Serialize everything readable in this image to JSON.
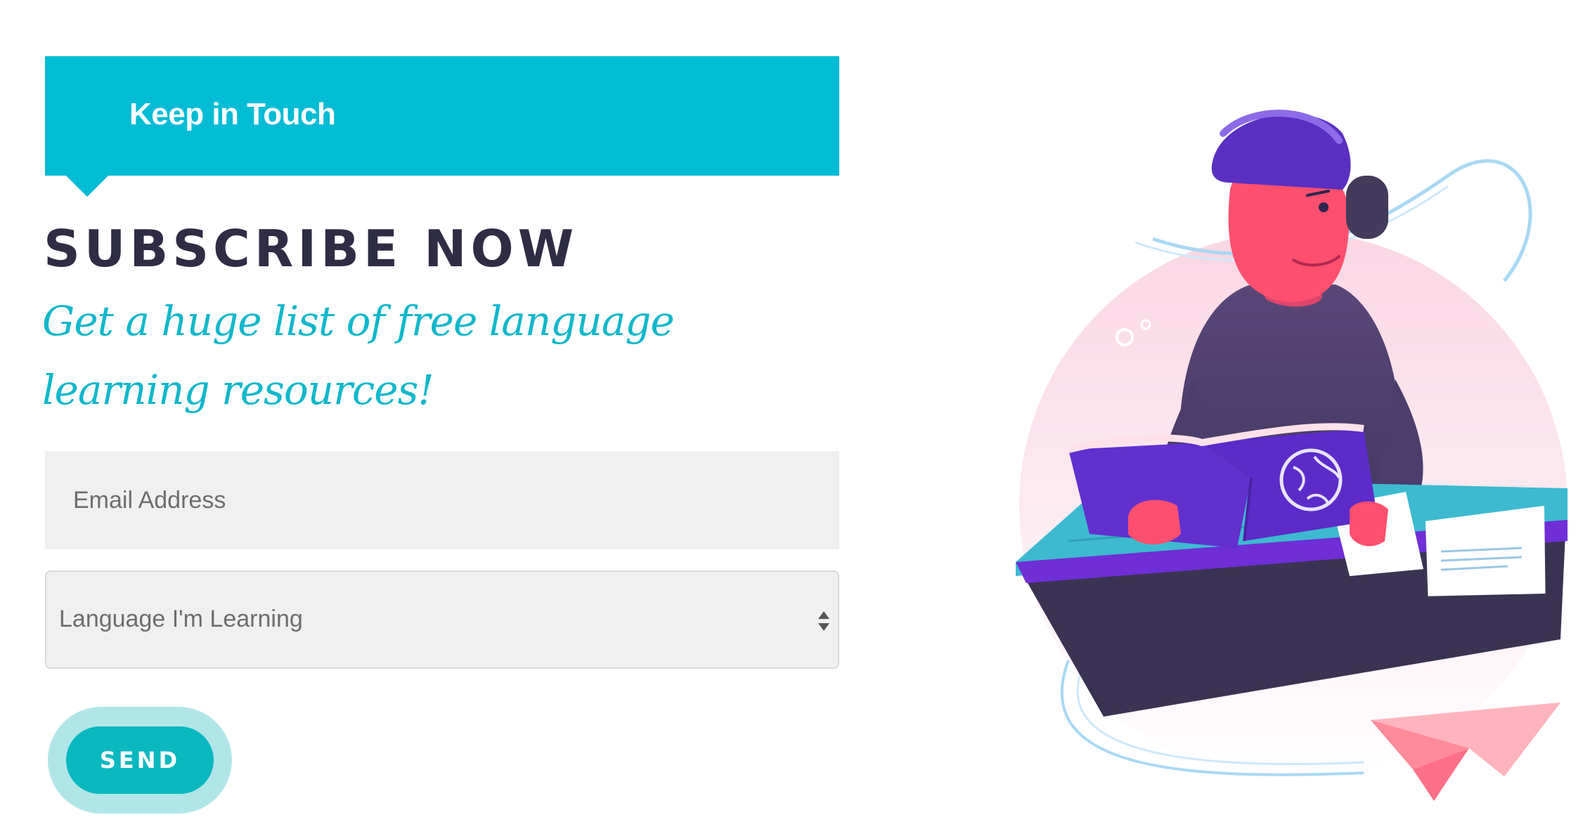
{
  "banner": {
    "title": "Keep in Touch"
  },
  "subscribe": {
    "heading": "SUBSCRIBE NOW",
    "tagline": "Get a huge list of free language learning resources!"
  },
  "form": {
    "email_placeholder": "Email Address",
    "language_select": {
      "selected": "Language I'm Learning"
    },
    "send_label": "SEND"
  },
  "colors": {
    "accent": "#00bcd4",
    "heading": "#2f2d45",
    "tagline": "#11b7cb",
    "button": "#0ab8c0",
    "button_halo": "#b1e6e9",
    "field_bg": "#f0f0f0"
  },
  "illustration": {
    "description_icon": "person-reading-book-with-headphones-illustration"
  }
}
